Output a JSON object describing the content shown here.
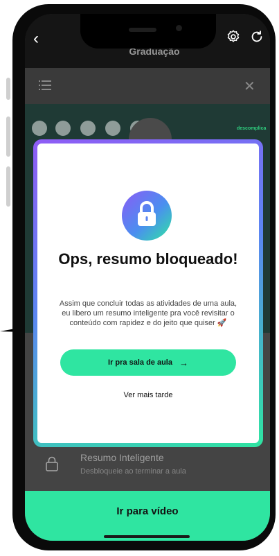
{
  "header": {
    "back_icon": "chevron-left-icon",
    "course_title": "Graduação",
    "settings_icon": "gear-icon",
    "refresh_icon": "refresh-icon"
  },
  "panel": {
    "menu_icon": "list-icon",
    "close_icon": "close-icon",
    "brand_tag": "descomplica"
  },
  "summary_row": {
    "title": "Resumo Inteligente",
    "subtitle": "Desbloqueie ao terminar a aula"
  },
  "video_button_label": "Ir para vídeo",
  "modal": {
    "title": "Ops, resumo bloqueado!",
    "body": "Assim que concluir todas as atividades de uma aula, eu libero um resumo inteligente pra você revisitar o conteúdo com rapidez e do jeito que quiser 🚀",
    "primary_label": "Ir pra sala de aula",
    "primary_arrow": "→",
    "secondary_label": "Ver mais tarde"
  },
  "colors": {
    "accent_green": "#2fe5a1",
    "gradient_purple": "#8f5cf5",
    "gradient_blue": "#5b86f2"
  }
}
